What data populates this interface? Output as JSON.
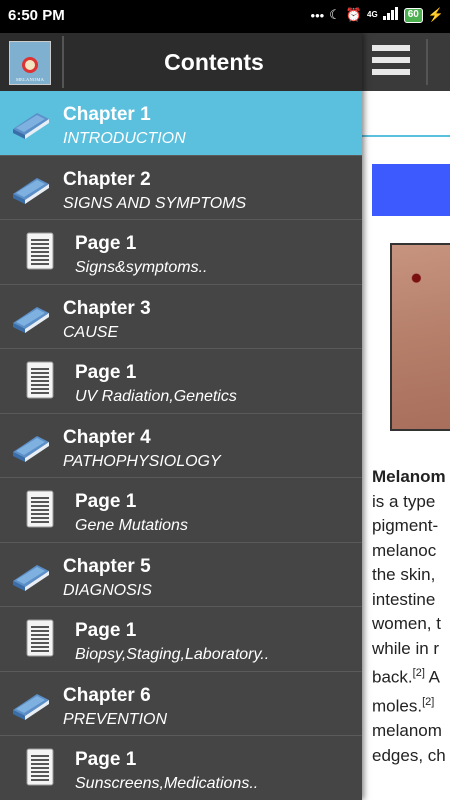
{
  "status_bar": {
    "time": "6:50 PM",
    "network_label": "4G",
    "battery": "60"
  },
  "drawer": {
    "title": "Contents",
    "logo_text": "MELANOMA",
    "items": [
      {
        "type": "chapter",
        "title": "Chapter 1",
        "subtitle": "INTRODUCTION",
        "active": true,
        "icon": "book-icon"
      },
      {
        "type": "chapter",
        "title": "Chapter 2",
        "subtitle": "SIGNS AND SYMPTOMS",
        "active": false,
        "icon": "book-icon"
      },
      {
        "type": "page",
        "title": "Page 1",
        "subtitle": "Signs&symptoms..",
        "active": false,
        "icon": "document-icon"
      },
      {
        "type": "chapter",
        "title": "Chapter 3",
        "subtitle": "CAUSE",
        "active": false,
        "icon": "book-icon"
      },
      {
        "type": "page",
        "title": "Page 1",
        "subtitle": "UV Radiation,Genetics",
        "active": false,
        "icon": "document-icon"
      },
      {
        "type": "chapter",
        "title": "Chapter 4",
        "subtitle": "PATHOPHYSIOLOGY",
        "active": false,
        "icon": "book-icon"
      },
      {
        "type": "page",
        "title": "Page 1",
        "subtitle": "Gene Mutations",
        "active": false,
        "icon": "document-icon"
      },
      {
        "type": "chapter",
        "title": "Chapter 5",
        "subtitle": "DIAGNOSIS",
        "active": false,
        "icon": "book-icon"
      },
      {
        "type": "page",
        "title": "Page 1",
        "subtitle": "Biopsy,Staging,Laboratory..",
        "active": false,
        "icon": "document-icon"
      },
      {
        "type": "chapter",
        "title": "Chapter 6",
        "subtitle": "PREVENTION",
        "active": false,
        "icon": "book-icon"
      },
      {
        "type": "page",
        "title": "Page 1",
        "subtitle": "Sunscreens,Medications..",
        "active": false,
        "icon": "document-icon"
      }
    ]
  },
  "article": {
    "lines": [
      {
        "text": "Melanom",
        "bold": true
      },
      {
        "text": "is a type"
      },
      {
        "text": "pigment-"
      },
      {
        "text": "melanoc"
      },
      {
        "text": "the skin,"
      },
      {
        "text": "intestine"
      },
      {
        "text": "women, t"
      },
      {
        "text": "while in r"
      },
      {
        "text": "back.",
        "sup": "[2]",
        "after": " A"
      },
      {
        "text": "moles.",
        "sup": "[2]"
      },
      {
        "text": "melanom"
      },
      {
        "text": "edges, ch"
      }
    ]
  },
  "colors": {
    "active_row": "#5bc0de",
    "drawer_bg": "#454545",
    "header_bg": "#2c2c2c",
    "banner": "#3d5afe"
  }
}
